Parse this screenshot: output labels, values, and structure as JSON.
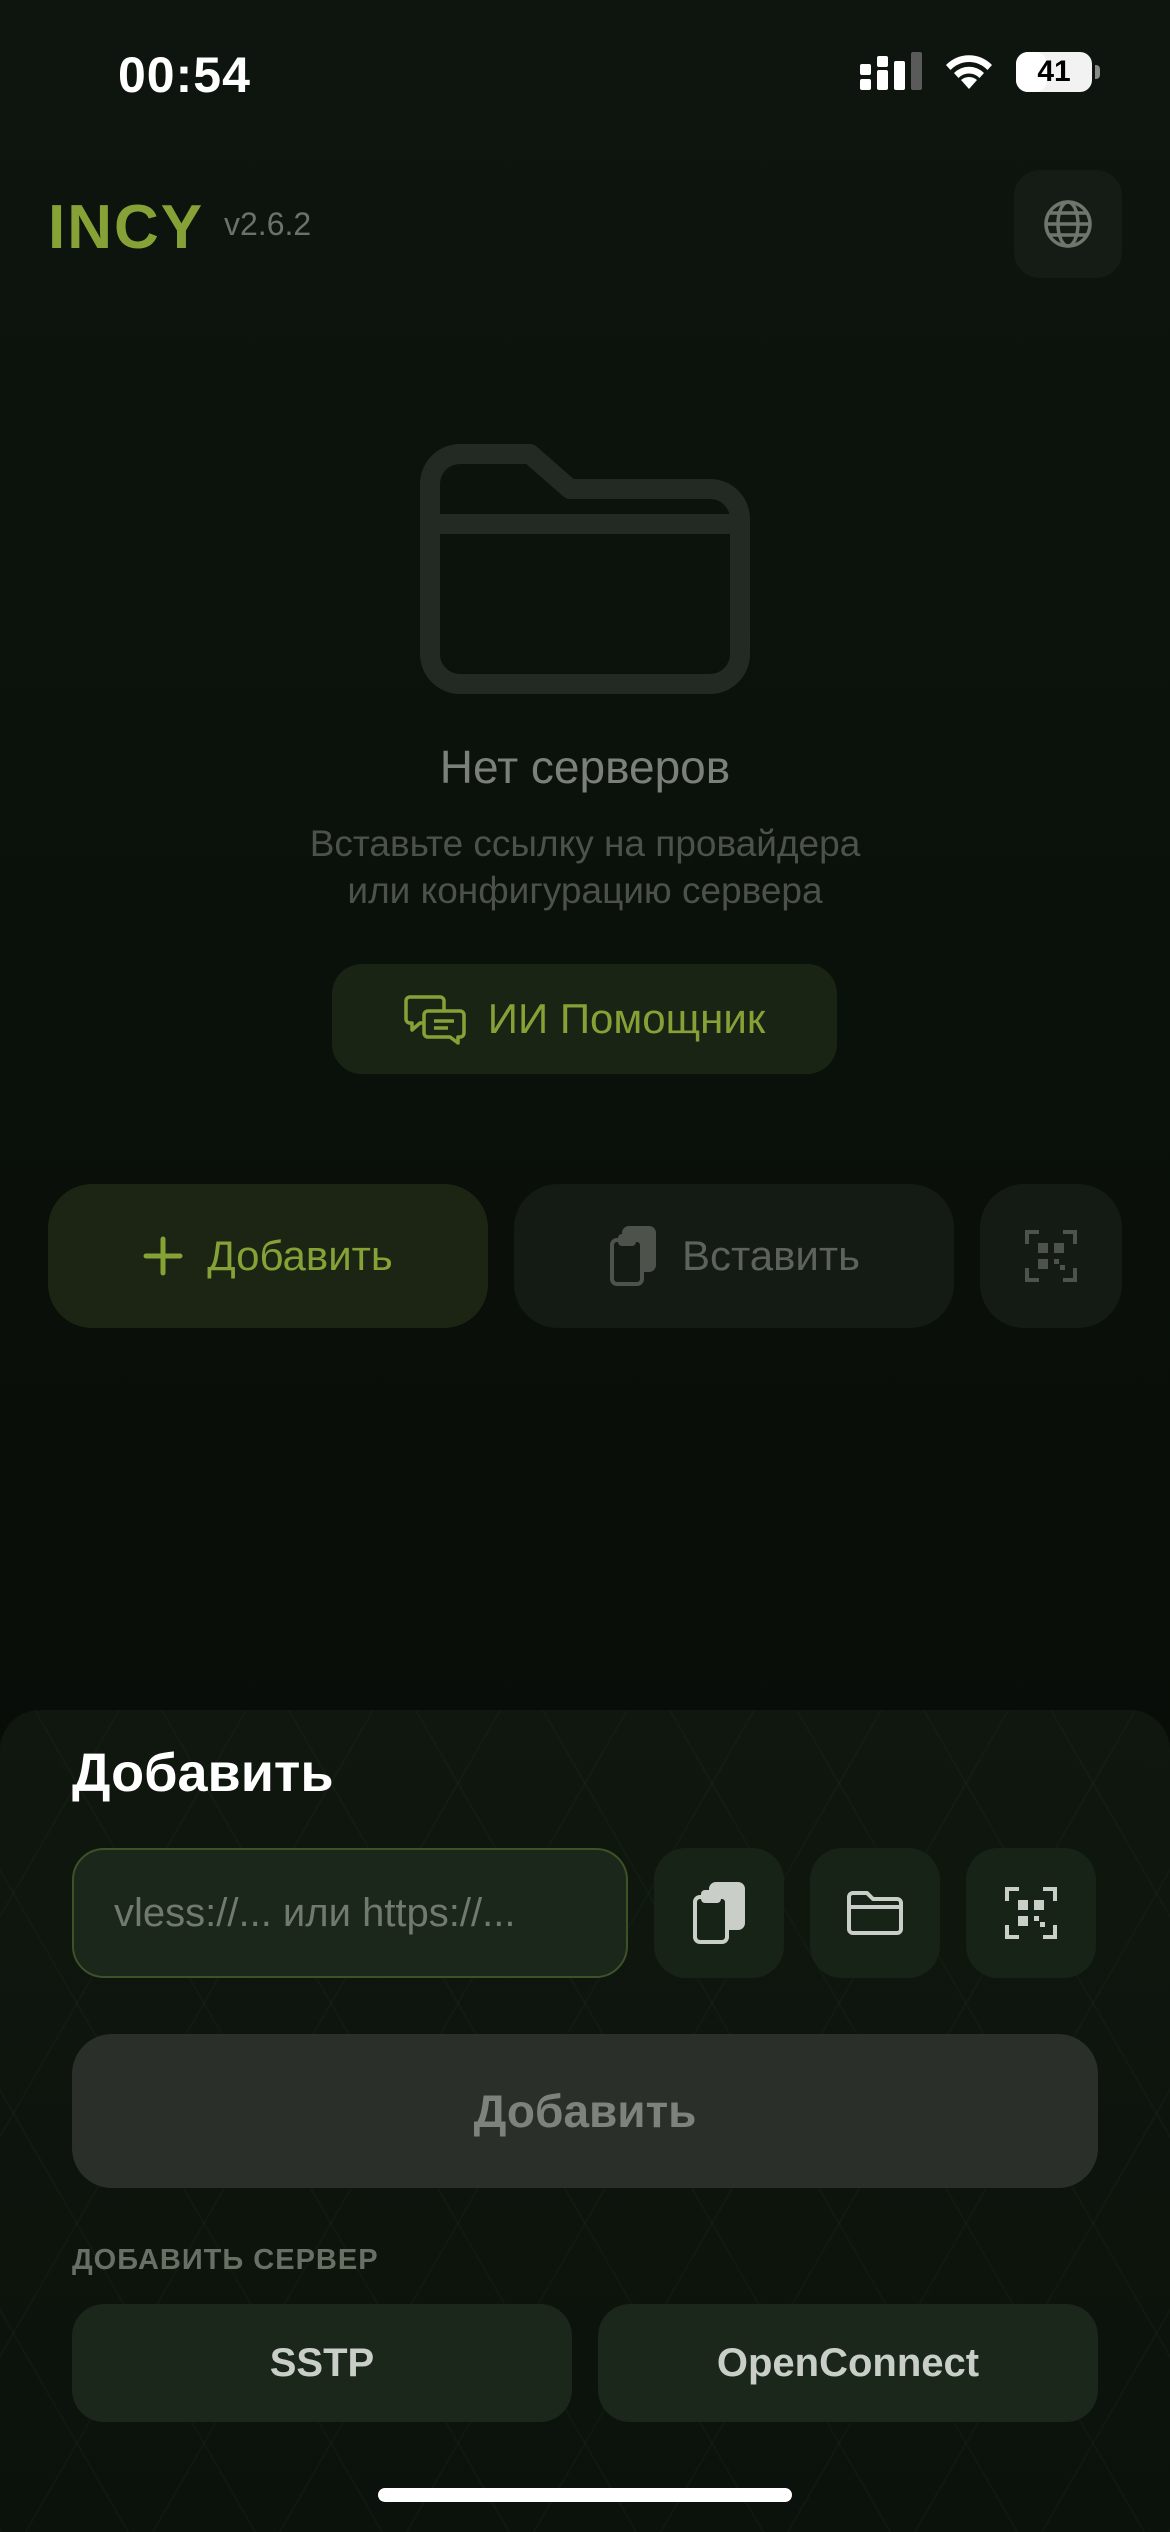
{
  "status_bar": {
    "time": "00:54",
    "battery": "41",
    "battery_fraction": 0.41,
    "icons": [
      "cellular-signal-icon",
      "wifi-icon",
      "battery-icon"
    ]
  },
  "header": {
    "title": "INCY",
    "version": "v2.6.2",
    "language_icon": "globe-icon"
  },
  "empty_state": {
    "icon": "folder-icon",
    "title": "Нет серверов",
    "subtitle_line1": "Вставьте ссылку на провайдера",
    "subtitle_line2": "или конфигурацию сервера",
    "assistant_button": "ИИ Помощник",
    "assistant_icon": "chat-bubbles-icon"
  },
  "actions": {
    "add_label": "Добавить",
    "add_icon": "plus-icon",
    "paste_label": "Вставить",
    "paste_icon": "clipboard-icon",
    "scan_icon": "qr-scan-icon"
  },
  "sheet": {
    "title": "Добавить",
    "input_placeholder": "vless://... или https://...",
    "input_value": "",
    "paste_icon": "clipboard-icon",
    "file_icon": "folder-icon",
    "scan_icon": "qr-scan-icon",
    "submit_label": "Добавить",
    "section_label": "ДОБАВИТЬ СЕРВЕР",
    "protocols": [
      "SSTP",
      "OpenConnect"
    ]
  },
  "colors": {
    "accent": "#86a237",
    "background": "#070a07",
    "sheet": "#0f170f",
    "muted_text": "#7b8178"
  }
}
